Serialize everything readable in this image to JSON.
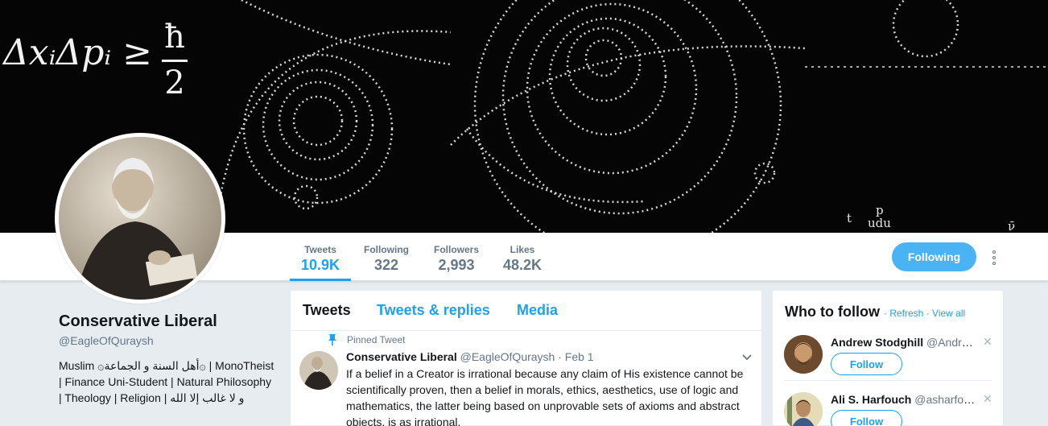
{
  "banner": {
    "equation": "ΔxᵢΔpᵢ ≥",
    "fraction_top": "ħ",
    "fraction_bottom": "2",
    "label_t": "t",
    "label_p": "p",
    "label_udu": "udu",
    "label_v": "ν̄"
  },
  "stats": [
    {
      "label": "Tweets",
      "value": "10.9K"
    },
    {
      "label": "Following",
      "value": "322"
    },
    {
      "label": "Followers",
      "value": "2,993"
    },
    {
      "label": "Likes",
      "value": "48.2K"
    }
  ],
  "following_button": "Following",
  "profile": {
    "name": "Conservative Liberal",
    "handle": "@EagleOfQuraysh",
    "bio": "Muslim ۞أهل السنة و الجماعة۞ | MonoTheist | Finance Uni-Student | Natural Philosophy | Theology | Religion | و لا غالب إلا الله"
  },
  "timeline": {
    "tabs": [
      "Tweets",
      "Tweets & replies",
      "Media"
    ],
    "pinned_label": "Pinned Tweet",
    "tweet": {
      "name": "Conservative Liberal",
      "handle": "@EagleOfQuraysh",
      "date": "· Feb 1",
      "text": "If a belief in a Creator is irrational because any claim of His existence cannot be scientifically proven, then a belief in morals, ethics, aesthetics, use of logic and mathematics, the latter being based on unprovable sets of axioms and abstract objects, is as irrational."
    }
  },
  "who_to_follow": {
    "title": "Who to follow",
    "refresh": "Refresh",
    "view_all": "View all",
    "suggestions": [
      {
        "name": "Andrew Stodghill",
        "handle": "@Andre...",
        "button": "Follow"
      },
      {
        "name": "Ali S. Harfouch",
        "handle": "@asharfou...",
        "button": "Follow"
      }
    ]
  },
  "colors": {
    "accent": "#1da1f2",
    "following_button": "#4ab3f4",
    "background": "#e6ecf0"
  }
}
